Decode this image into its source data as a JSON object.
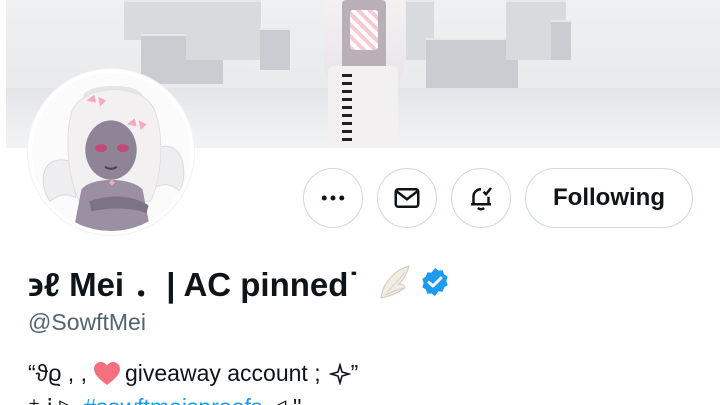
{
  "profile": {
    "display_name": "϶ℓ Mei ．| AC pinned˙",
    "handle": "@SowftMei",
    "verified": true,
    "name_emoji": "wing-icon"
  },
  "actions": {
    "more_icon": "more-icon",
    "message_icon": "mail-icon",
    "notify_icon": "bell-check-icon",
    "follow_label": "Following"
  },
  "bio": {
    "line1_prefix": "“ϑϱ  , ,",
    "line1_text": "giveaway account ;",
    "line1_suffix": "”",
    "line2_prefix": "    ⁺ ⁞ ▷ ",
    "line2_hashtag": "#sowftmeisproofs",
    "line2_suffix": " ◁ ''"
  },
  "colors": {
    "accent": "#1d9bf0",
    "heart": "#f4707f",
    "text": "#0f1419",
    "muted": "#536471",
    "border": "#cfd9de"
  }
}
